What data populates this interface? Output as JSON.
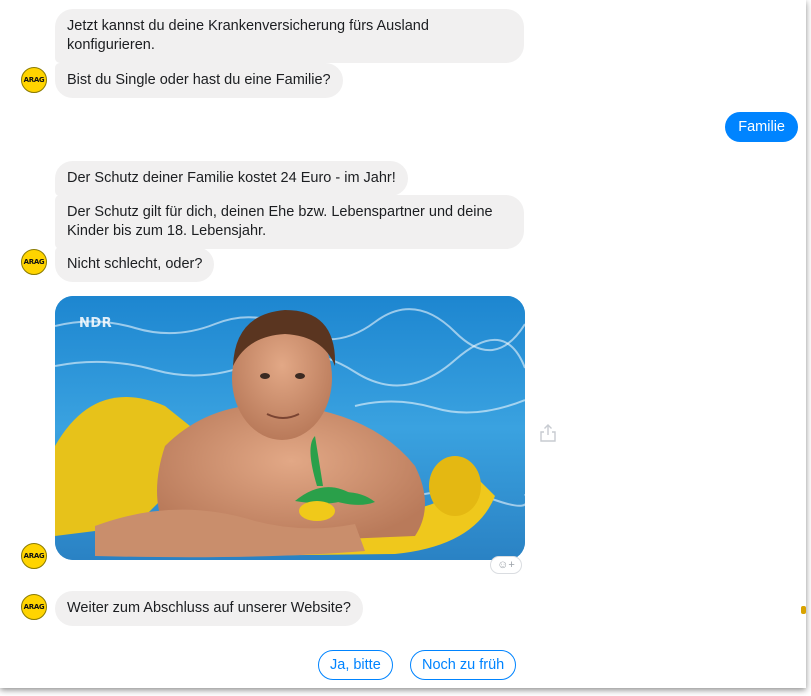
{
  "bot": {
    "avatar_text": "ARAG"
  },
  "messages": {
    "m1": "Jetzt kannst du deine Krankenversicherung fürs Ausland konfigurieren.",
    "m2": "Bist du Single oder hast du eine Familie?",
    "user_reply": "Familie",
    "m3": "Der Schutz deiner Familie kostet 24 Euro - im Jahr!",
    "m4": "Der Schutz gilt für dich, deinen Ehe bzw. Lebenspartner und deine Kinder bis zum 18. Lebensjahr.",
    "m5": "Nicht schlecht, oder?",
    "image_watermark": "NDR",
    "m6": "Weiter zum Abschluss auf unserer Website?"
  },
  "quick_replies": [
    "Ja, bitte",
    "Noch zu früh"
  ],
  "icons": {
    "share": "share-icon",
    "reaction": "add-reaction-icon",
    "avatar": "arag-logo-icon"
  },
  "colors": {
    "accent": "#0084ff",
    "bubble_gray": "#f1f0f0",
    "avatar_yellow": "#ffd400"
  }
}
